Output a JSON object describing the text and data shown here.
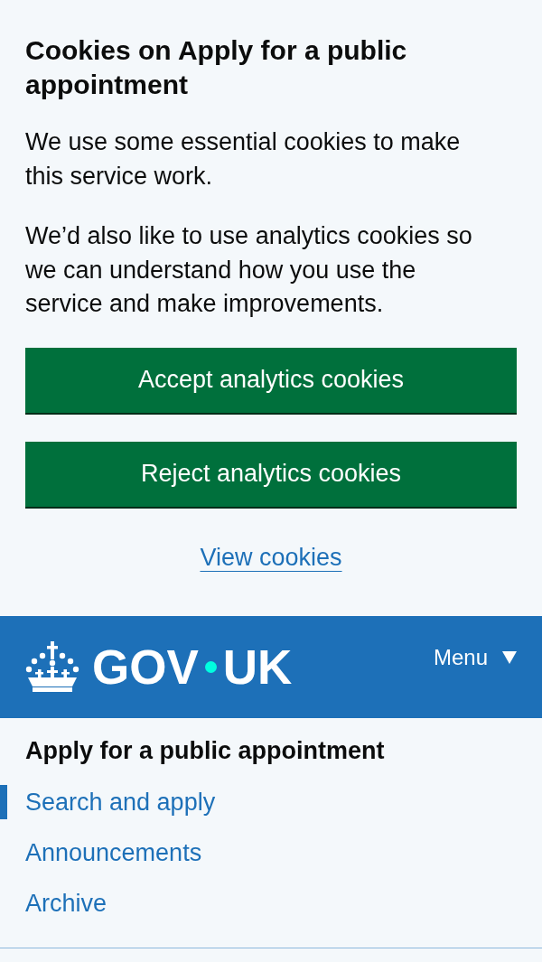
{
  "cookie_banner": {
    "heading": "Cookies on Apply for a public appointment",
    "paragraphs": [
      "We use some essential cookies to make this service work.",
      "We’d also like to use analytics cookies so we can understand how you use the service and make improvements."
    ],
    "buttons": [
      "Accept analytics cookies",
      "Reject analytics cookies"
    ],
    "link": "View cookies"
  },
  "header": {
    "logo": {
      "left": "GOV",
      "right": "UK"
    },
    "menu": {
      "label": "Menu",
      "expanded": false
    }
  },
  "service_nav": {
    "title": "Apply for a public appointment",
    "items": [
      {
        "label": "Search and apply",
        "selected": true
      },
      {
        "label": "Announcements",
        "selected": false
      },
      {
        "label": "Archive",
        "selected": false
      }
    ]
  }
}
